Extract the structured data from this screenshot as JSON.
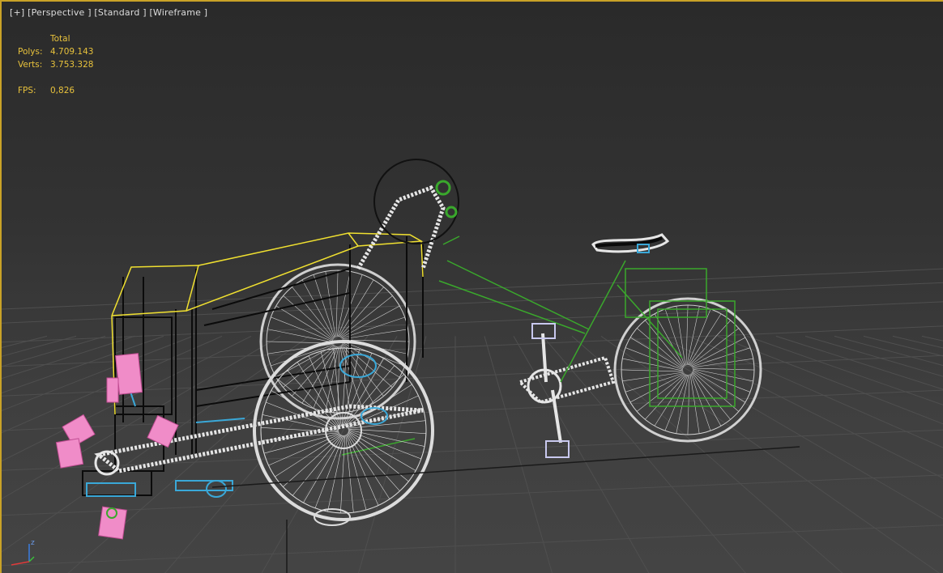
{
  "viewport": {
    "menu_plus": "[+]",
    "view_name": "[Perspective ]",
    "shading_mode": "[Standard ]",
    "display_mode": "[Wireframe ]"
  },
  "stats": {
    "header": "Total",
    "polys_label": "Polys:",
    "polys_value": "4.709.143",
    "verts_label": "Verts:",
    "verts_value": "3.753.328",
    "fps_label": "FPS:",
    "fps_value": "0,826"
  },
  "gizmo": {
    "z_label": "z"
  },
  "colors": {
    "frame_border": "#c9a227",
    "stats_text": "#e8c23c",
    "wire_white": "#dcdcdc",
    "wire_black": "#0a0a0a",
    "wire_yellow": "#f0e030",
    "wire_green": "#3aa82c",
    "wire_pink": "#f08cc8",
    "wire_blue": "#3aa8d8",
    "grid": "#4e4e4e"
  }
}
